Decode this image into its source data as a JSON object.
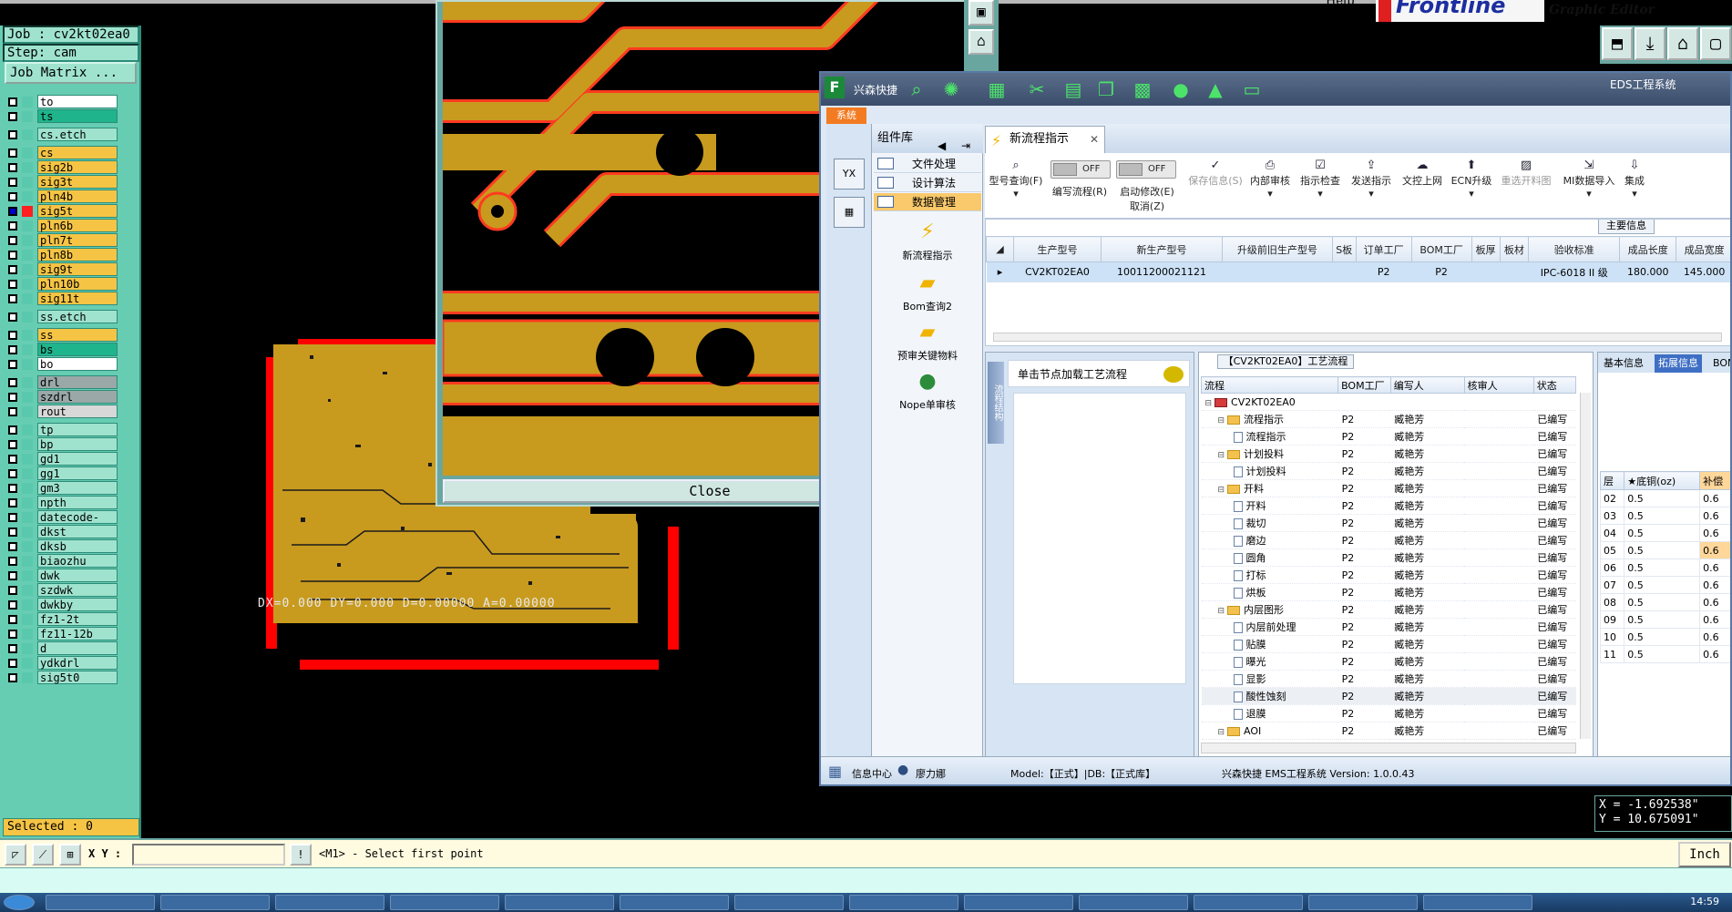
{
  "genesis": {
    "job_label": "Job : cv2kt02ea0",
    "step_label": "Step: cam",
    "job_matrix": "Job Matrix ...",
    "selected": "Selected : 0",
    "help": "Help",
    "logo_text": "Frontline",
    "editor_title": "Graphic Editor",
    "close_label": "Close",
    "dx_readout": "DX=0.000 DY=0.000 D=0.00000 A=0.00000",
    "coord_x": "X = -1.692538\"",
    "coord_y": "Y = 10.675091\"",
    "xy_label": "X Y :",
    "xy_value": "",
    "prompt": "<M1> - Select first point",
    "units": "Inch",
    "layers": [
      {
        "name": "to",
        "color": "#ffffff",
        "group": 0
      },
      {
        "name": "ts",
        "color": "#1fb48c",
        "group": 0
      },
      {
        "name": "cs.etch",
        "color": "#9fe3cf",
        "group": 1
      },
      {
        "name": "cs",
        "color": "#f5c445",
        "group": 2
      },
      {
        "name": "sig2b",
        "color": "#f5c445",
        "group": 2
      },
      {
        "name": "sig3t",
        "color": "#f5c445",
        "group": 2
      },
      {
        "name": "pln4b",
        "color": "#f5c445",
        "group": 2
      },
      {
        "name": "sig5t",
        "color": "#f5c445",
        "group": 2,
        "active": true
      },
      {
        "name": "pln6b",
        "color": "#f5c445",
        "group": 2
      },
      {
        "name": "pln7t",
        "color": "#f5c445",
        "group": 2
      },
      {
        "name": "pln8b",
        "color": "#f5c445",
        "group": 2
      },
      {
        "name": "sig9t",
        "color": "#f5c445",
        "group": 2
      },
      {
        "name": "pln10b",
        "color": "#f5c445",
        "group": 2
      },
      {
        "name": "sig11t",
        "color": "#f5c445",
        "group": 2
      },
      {
        "name": "ss.etch",
        "color": "#9fe3cf",
        "group": 3
      },
      {
        "name": "ss",
        "color": "#f5c445",
        "group": 4
      },
      {
        "name": "bs",
        "color": "#1fb48c",
        "group": 4
      },
      {
        "name": "bo",
        "color": "#ffffff",
        "group": 4
      },
      {
        "name": "drl",
        "color": "#9aa8a8",
        "group": 5
      },
      {
        "name": "szdrl",
        "color": "#9aa8a8",
        "group": 5
      },
      {
        "name": "rout",
        "color": "#d8d8d8",
        "group": 5
      },
      {
        "name": "tp",
        "color": "#9fe3cf",
        "group": 6
      },
      {
        "name": "bp",
        "color": "#9fe3cf",
        "group": 6
      },
      {
        "name": "gd1",
        "color": "#9fe3cf",
        "group": 6
      },
      {
        "name": "gg1",
        "color": "#9fe3cf",
        "group": 6
      },
      {
        "name": "gm3",
        "color": "#9fe3cf",
        "group": 6
      },
      {
        "name": "npth",
        "color": "#9fe3cf",
        "group": 6
      },
      {
        "name": "datecode-pth",
        "color": "#9fe3cf",
        "group": 6
      },
      {
        "name": "dkst",
        "color": "#9fe3cf",
        "group": 6
      },
      {
        "name": "dksb",
        "color": "#9fe3cf",
        "group": 6
      },
      {
        "name": "biaozhu",
        "color": "#9fe3cf",
        "group": 6
      },
      {
        "name": "dwk",
        "color": "#9fe3cf",
        "group": 6
      },
      {
        "name": "szdwk",
        "color": "#9fe3cf",
        "group": 6
      },
      {
        "name": "dwkby",
        "color": "#9fe3cf",
        "group": 6
      },
      {
        "name": "fz1-2t",
        "color": "#9fe3cf",
        "group": 6
      },
      {
        "name": "fz11-12b",
        "color": "#9fe3cf",
        "group": 6
      },
      {
        "name": "d",
        "color": "#9fe3cf",
        "group": 6
      },
      {
        "name": "ydkdrl",
        "color": "#9fe3cf",
        "group": 6
      },
      {
        "name": "sig5t0",
        "color": "#9fe3cf",
        "group": 6
      }
    ]
  },
  "ems": {
    "title": "兴森快捷",
    "system_name": "EDS工程系统",
    "sys_tab": "系统",
    "complib_title": "组件库",
    "complib_items": [
      "文件处理",
      "设计算法",
      "数据管理"
    ],
    "tools": [
      "新流程指示",
      "Bom查询2",
      "预审关键物料",
      "Nope单审核"
    ],
    "tab_title": "新流程指示",
    "ribbon": [
      {
        "icon": "search-icon",
        "label": "型号查询(F)"
      },
      {
        "icon": "toggle",
        "label": "编写流程(R)",
        "state": "OFF"
      },
      {
        "icon": "toggle",
        "label": "启动修改(E)\n取消(Z)",
        "state": "OFF"
      },
      {
        "icon": "check-icon",
        "label": "保存信息(S)"
      },
      {
        "icon": "printer-icon",
        "label": "内部审核"
      },
      {
        "icon": "check-icon",
        "label": "指示检查"
      },
      {
        "icon": "upload-icon",
        "label": "发送指示"
      },
      {
        "icon": "cloud-icon",
        "label": "文控上网"
      },
      {
        "icon": "upgrade-icon",
        "label": "ECN升级"
      },
      {
        "icon": "image-icon",
        "label": "重选开料图"
      },
      {
        "icon": "import-icon",
        "label": "MI数据导入"
      },
      {
        "icon": "integrate-icon",
        "label": "集成"
      }
    ],
    "main_info_caption": "主要信息",
    "grid_headers": [
      "生产型号",
      "新生产型号",
      "升级前旧生产型号",
      "S板",
      "订单工厂",
      "BOM工厂",
      "板厚",
      "板材",
      "验收标准",
      "成品长度",
      "成品宽度"
    ],
    "grid_row": [
      "CV2KT02EA0",
      "10011200021121",
      "",
      "",
      "P2",
      "P2",
      "",
      "",
      "IPC-6018 II 级",
      "180.000",
      "145.000"
    ],
    "flow_caption": "【CV2KT02EA0】工艺流程",
    "flow_side_tab": "流程结构",
    "flow_hint": "单击节点加载工艺流程",
    "tree_headers": [
      "流程",
      "BOM工厂",
      "编写人",
      "核审人",
      "状态"
    ],
    "tree_rows": [
      {
        "label": "CV2KT02EA0",
        "level": 0,
        "type": "root",
        "bom": "",
        "writer": "",
        "status": ""
      },
      {
        "label": "流程指示",
        "level": 1,
        "type": "folder",
        "bom": "P2",
        "writer": "臧艳芳",
        "status": "已编写"
      },
      {
        "label": "流程指示",
        "level": 2,
        "type": "doc",
        "bom": "P2",
        "writer": "臧艳芳",
        "status": "已编写"
      },
      {
        "label": "计划投料",
        "level": 1,
        "type": "folder",
        "bom": "P2",
        "writer": "臧艳芳",
        "status": "已编写"
      },
      {
        "label": "计划投料",
        "level": 2,
        "type": "doc",
        "bom": "P2",
        "writer": "臧艳芳",
        "status": "已编写"
      },
      {
        "label": "开料",
        "level": 1,
        "type": "folder",
        "bom": "P2",
        "writer": "臧艳芳",
        "status": "已编写"
      },
      {
        "label": "开料",
        "level": 2,
        "type": "doc",
        "bom": "P2",
        "writer": "臧艳芳",
        "status": "已编写"
      },
      {
        "label": "裁切",
        "level": 2,
        "type": "doc",
        "bom": "P2",
        "writer": "臧艳芳",
        "status": "已编写"
      },
      {
        "label": "磨边",
        "level": 2,
        "type": "doc",
        "bom": "P2",
        "writer": "臧艳芳",
        "status": "已编写"
      },
      {
        "label": "圆角",
        "level": 2,
        "type": "doc",
        "bom": "P2",
        "writer": "臧艳芳",
        "status": "已编写"
      },
      {
        "label": "打标",
        "level": 2,
        "type": "doc",
        "bom": "P2",
        "writer": "臧艳芳",
        "status": "已编写"
      },
      {
        "label": "烘板",
        "level": 2,
        "type": "doc",
        "bom": "P2",
        "writer": "臧艳芳",
        "status": "已编写"
      },
      {
        "label": "内层图形",
        "level": 1,
        "type": "folder",
        "bom": "P2",
        "writer": "臧艳芳",
        "status": "已编写"
      },
      {
        "label": "内层前处理",
        "level": 2,
        "type": "doc",
        "bom": "P2",
        "writer": "臧艳芳",
        "status": "已编写"
      },
      {
        "label": "贴膜",
        "level": 2,
        "type": "doc",
        "bom": "P2",
        "writer": "臧艳芳",
        "status": "已编写"
      },
      {
        "label": "曝光",
        "level": 2,
        "type": "doc",
        "bom": "P2",
        "writer": "臧艳芳",
        "status": "已编写"
      },
      {
        "label": "显影",
        "level": 2,
        "type": "doc",
        "bom": "P2",
        "writer": "臧艳芳",
        "status": "已编写"
      },
      {
        "label": "酸性蚀刻",
        "level": 2,
        "type": "doc",
        "bom": "P2",
        "writer": "臧艳芳",
        "status": "已编写",
        "highlight": true
      },
      {
        "label": "退膜",
        "level": 2,
        "type": "doc",
        "bom": "P2",
        "writer": "臧艳芳",
        "status": "已编写"
      },
      {
        "label": "AOI",
        "level": 1,
        "type": "folder",
        "bom": "P2",
        "writer": "臧艳芳",
        "status": "已编写"
      }
    ],
    "right_tabs": [
      "基本信息",
      "拓展信息",
      "BOM"
    ],
    "layer_headers": [
      "层",
      "★底铜(oz)",
      "补偿"
    ],
    "layer_rows": [
      [
        "02",
        "0.5",
        "0.6"
      ],
      [
        "03",
        "0.5",
        "0.6"
      ],
      [
        "04",
        "0.5",
        "0.6"
      ],
      [
        "05",
        "0.5",
        "0.6"
      ],
      [
        "06",
        "0.5",
        "0.6"
      ],
      [
        "07",
        "0.5",
        "0.6"
      ],
      [
        "08",
        "0.5",
        "0.6"
      ],
      [
        "09",
        "0.5",
        "0.6"
      ],
      [
        "10",
        "0.5",
        "0.6"
      ],
      [
        "11",
        "0.5",
        "0.6"
      ]
    ],
    "status_info_center": "信息中心",
    "status_user": "廖力娜",
    "status_model": "Model:【正式】|DB:【正式库】",
    "status_version": "兴森快捷  EMS工程系统  Version: 1.0.0.43"
  },
  "taskbar": {
    "clock": "14:59"
  },
  "colors": {
    "copper": "#c89b1f",
    "trace_outline": "#ff3b1f",
    "panel_green": "#66cdb3",
    "accent_blue": "#3f6fc4"
  }
}
